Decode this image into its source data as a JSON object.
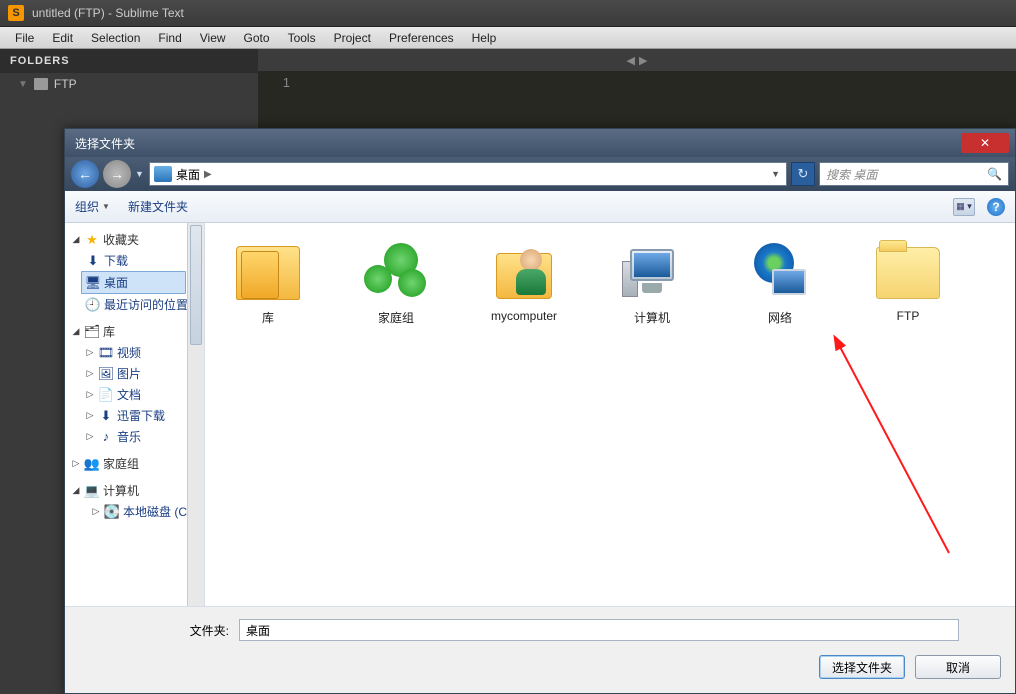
{
  "sublime": {
    "title": "untitled (FTP) - Sublime Text",
    "menu": [
      "File",
      "Edit",
      "Selection",
      "Find",
      "View",
      "Goto",
      "Tools",
      "Project",
      "Preferences",
      "Help"
    ],
    "sidebar_header": "FOLDERS",
    "sidebar_root": "FTP",
    "gutter_line": "1"
  },
  "dialog": {
    "title": "选择文件夹",
    "breadcrumb": {
      "location": "桌面"
    },
    "search_placeholder": "搜索 桌面",
    "toolbar": {
      "organize": "组织",
      "new_folder": "新建文件夹"
    },
    "tree": {
      "favorites": {
        "label": "收藏夹",
        "items": [
          {
            "label": "下载",
            "icon": "download"
          },
          {
            "label": "桌面",
            "icon": "desktop",
            "selected": true
          },
          {
            "label": "最近访问的位置",
            "icon": "recent"
          }
        ]
      },
      "libraries": {
        "label": "库",
        "items": [
          {
            "label": "视频",
            "icon": "video"
          },
          {
            "label": "图片",
            "icon": "picture"
          },
          {
            "label": "文档",
            "icon": "doc"
          },
          {
            "label": "迅雷下载",
            "icon": "xl"
          },
          {
            "label": "音乐",
            "icon": "music"
          }
        ]
      },
      "homegroup": {
        "label": "家庭组"
      },
      "computer": {
        "label": "计算机",
        "items": [
          {
            "label": "本地磁盘 (C:)",
            "icon": "drive"
          }
        ]
      }
    },
    "items": [
      {
        "label": "库",
        "icon": "lib"
      },
      {
        "label": "家庭组",
        "icon": "homegroup"
      },
      {
        "label": "mycomputer",
        "icon": "user"
      },
      {
        "label": "计算机",
        "icon": "computer"
      },
      {
        "label": "网络",
        "icon": "network"
      },
      {
        "label": "FTP",
        "icon": "folder"
      }
    ],
    "folder_label": "文件夹:",
    "folder_value": "桌面",
    "select_btn": "选择文件夹",
    "cancel_btn": "取消"
  }
}
